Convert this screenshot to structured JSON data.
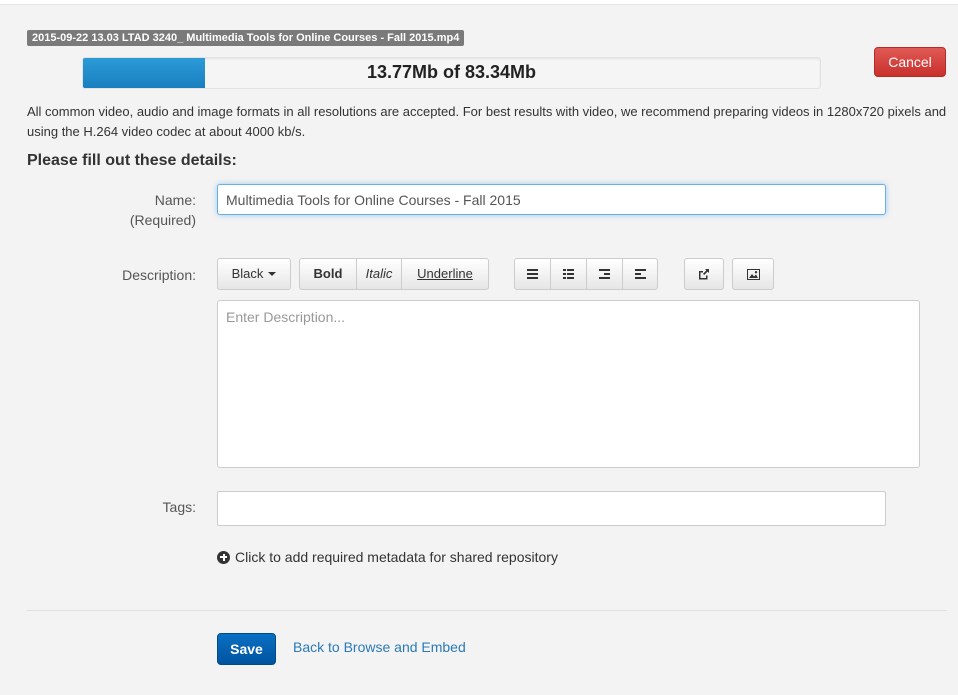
{
  "upload": {
    "file_name": "2015-09-22 13.03 LTAD 3240_ Multimedia Tools for Online Courses - Fall 2015.mp4",
    "progress_text": "13.77Mb of 83.34Mb",
    "progress_fraction": 0.1652,
    "cancel_label": "Cancel",
    "info": "All common video, audio and image formats in all resolutions are accepted.  For best results with video, we recommend preparing videos in 1280x720 pixels and using the H.264 video codec at about 4000 kb/s."
  },
  "form": {
    "title": "Please fill out these details:",
    "name_label": "Name:",
    "name_required": "(Required)",
    "name_value": "Multimedia Tools for Online Courses - Fall 2015",
    "description_label": "Description:",
    "description_placeholder": "Enter Description...",
    "tags_label": "Tags:",
    "metadata_link": "Click to add required metadata for shared repository"
  },
  "toolbar": {
    "color_label": "Black",
    "bold_label": "Bold",
    "italic_label": "Italic",
    "underline_label": "Underline"
  },
  "footer": {
    "save_label": "Save",
    "back_label": "Back to Browse and Embed"
  },
  "colors": {
    "progress": "#1a7fc0",
    "cancel": "#c9302c",
    "save": "#00549f",
    "link": "#2a7ab8"
  }
}
